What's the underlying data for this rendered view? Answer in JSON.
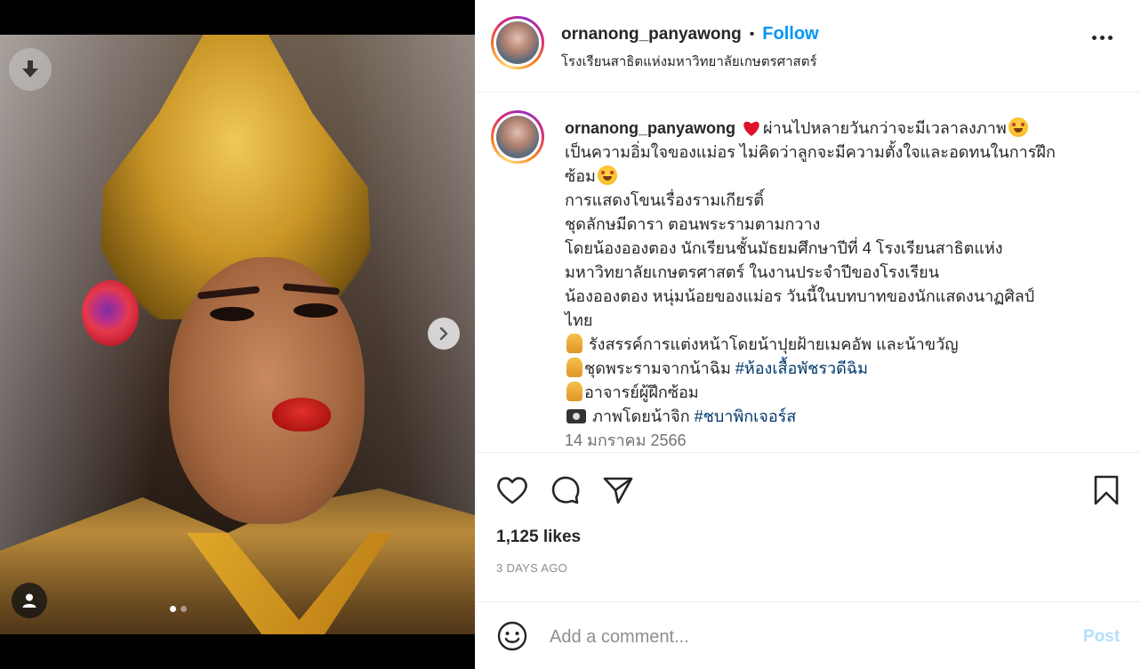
{
  "post": {
    "username": "ornanong_panyawong",
    "follow_label": "Follow",
    "separator": "•",
    "location": "โรงเรียนสาธิตแห่งมหาวิทยาลัยเกษตรศาสตร์",
    "likes": "1,125 likes",
    "time_ago": "3 DAYS AGO",
    "carousel": {
      "total": 2,
      "current": 1
    }
  },
  "caption": {
    "username": "ornanong_panyawong",
    "lines": [
      "ผ่านไปหลายวันกว่าจะมีเวลาลงภาพ",
      "เป็นความอิ่มใจของแม่อร ไม่คิดว่าลูกจะมีความตั้งใจและอดทนในการฝึก",
      "ซ้อม",
      "การแสดงโขนเรื่องรามเกียรติ์",
      "ชุดลักษมีดารา ตอนพระรามตามกวาง",
      "โดยน้องอองตอง นักเรียนชั้นมัธยมศึกษาปีที่ 4 โรงเรียนสาธิตแห่ง",
      "มหาวิทยาลัยเกษตรศาสตร์ ในงานประจำปีของโรงเรียน",
      "น้องอองตอง หนุ่มน้อยของแม่อร วันนี้ในบทบาทของนักแสดงนาฏศิลป์",
      "ไทย",
      " รังสรรค์การแต่งหน้าโดยน้าปุยฝ้ายเมคอัพ และน้าขวัญ",
      "ชุดพระรามจากน้าฉิม ",
      "อาจารย์ผู้ฝึกซ้อม",
      " ภาพโดยน้าจิก "
    ],
    "hashtags": [
      "#ห้องเสื้อพัชรวดีฉิม",
      "#ชบาพิกเจอร์ส"
    ],
    "date": "14 มกราคม 2566"
  },
  "comment": {
    "placeholder": "Add a comment...",
    "post_label": "Post"
  },
  "icons": {
    "download": "download-icon",
    "next": "chevron-right-icon",
    "user": "user-icon",
    "like": "heart-icon",
    "comment": "comment-icon",
    "share": "send-icon",
    "save": "bookmark-icon",
    "emoji": "emoji-icon",
    "more": "more-options-icon"
  },
  "colors": {
    "follow": "#0095f6",
    "hashtag": "#00376b",
    "post_disabled": "#b2dffc",
    "text": "#262626",
    "muted": "#8e8e8e"
  }
}
